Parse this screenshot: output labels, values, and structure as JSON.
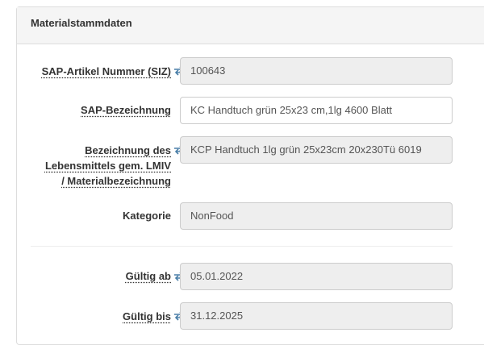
{
  "panel": {
    "title": "Materialstammdaten"
  },
  "fields": {
    "sap_artikel_nummer": {
      "label": "SAP-Artikel Nummer (SIZ)",
      "value": "100643"
    },
    "sap_bezeichnung": {
      "label": "SAP-Bezeichnung",
      "value": "KC Handtuch grün 25x23 cm,1lg 4600 Blatt"
    },
    "lmiv_bezeichnung": {
      "label_line1": "Bezeichnung des",
      "label_line2": "Lebensmittels gem. LMIV",
      "label_line3": "/ Materialbezeichnung",
      "value": "KCP Handtuch 1lg grün 25x23cm 20x230Tü  6019"
    },
    "kategorie": {
      "label": "Kategorie",
      "value": "NonFood"
    },
    "gueltig_ab": {
      "label": "Gültig ab",
      "value": "05.01.2022"
    },
    "gueltig_bis": {
      "label": "Gültig bis",
      "value": "31.12.2025"
    }
  },
  "icons": {
    "sync": "sync-arrows-icon",
    "sync_color": "#4a7fa8"
  }
}
